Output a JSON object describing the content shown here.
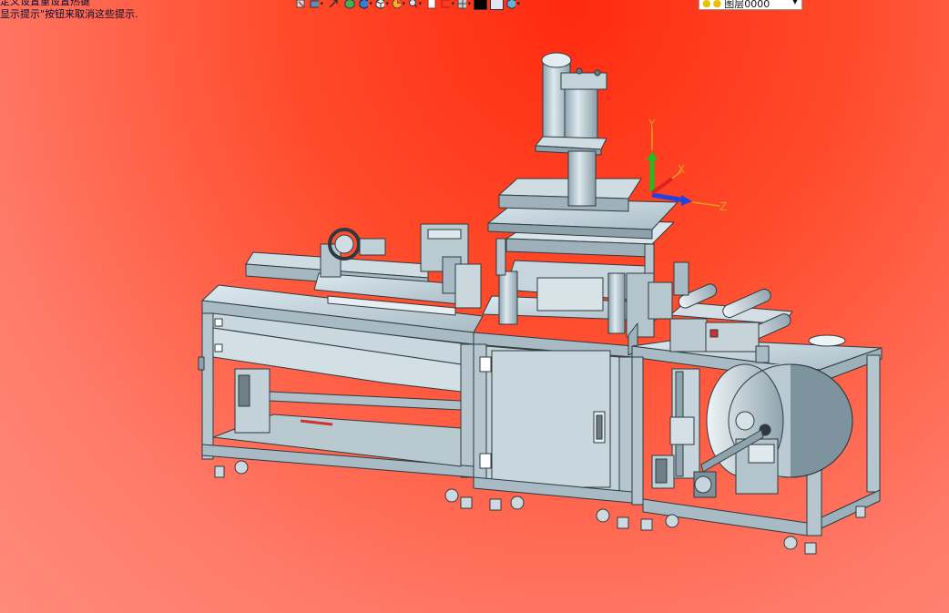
{
  "hints": {
    "line1": "定义设置重设置热键",
    "line2": "显示提示\"按钮来取消这些提示."
  },
  "toolbar": {
    "icons": [
      "cursor-icon",
      "selection-filter-icon",
      "arrow-icon",
      "cube-green-icon",
      "cube-blue-icon",
      "view-cube-icon",
      "render-icon",
      "zoom-icon",
      "page-icon",
      "frame-icon",
      "grid-icon",
      "color-black-swatch",
      "color-white-swatch",
      "shape-icon"
    ],
    "layer_value": "图层0000"
  },
  "triad": {
    "x_label": "X",
    "y_label": "Y",
    "z_label": "Z"
  },
  "colors": {
    "background_top": "#ff2a10",
    "background_bottom": "#ff8a7a",
    "machine_fill": "#c3d4dc",
    "machine_line": "#2e3a40"
  }
}
